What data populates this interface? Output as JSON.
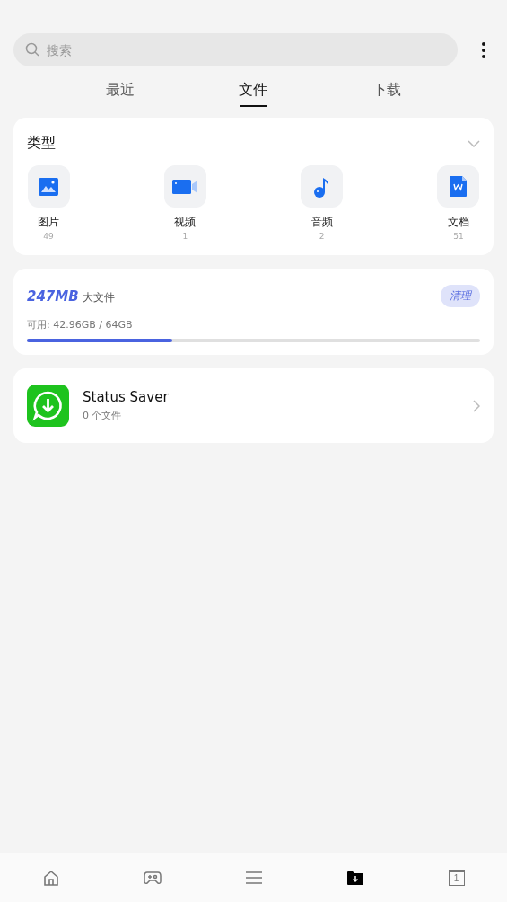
{
  "search": {
    "placeholder": "搜索"
  },
  "tabs": [
    {
      "label": "最近",
      "selected": false
    },
    {
      "label": "文件",
      "selected": true
    },
    {
      "label": "下载",
      "selected": false
    }
  ],
  "types": {
    "title": "类型",
    "expanded": true,
    "items": [
      {
        "kind": "image",
        "label": "图片",
        "count": "49"
      },
      {
        "kind": "video",
        "label": "视频",
        "count": "1"
      },
      {
        "kind": "audio",
        "label": "音频",
        "count": "2"
      },
      {
        "kind": "document",
        "label": "文档",
        "count": "51"
      }
    ]
  },
  "storage": {
    "size": "247MB",
    "size_label": "大文件",
    "clean_button": "清理",
    "available": "可用: 42.96GB / 64GB",
    "level": 0.32
  },
  "apps": [
    {
      "name": "Status Saver",
      "files": "0 个文件"
    }
  ],
  "bottom_nav": [
    {
      "kind": "home",
      "selected": false
    },
    {
      "kind": "games",
      "selected": false
    },
    {
      "kind": "menu",
      "selected": false
    },
    {
      "kind": "downloads",
      "selected": true
    },
    {
      "kind": "tabs",
      "selected": false,
      "count": "1"
    }
  ]
}
